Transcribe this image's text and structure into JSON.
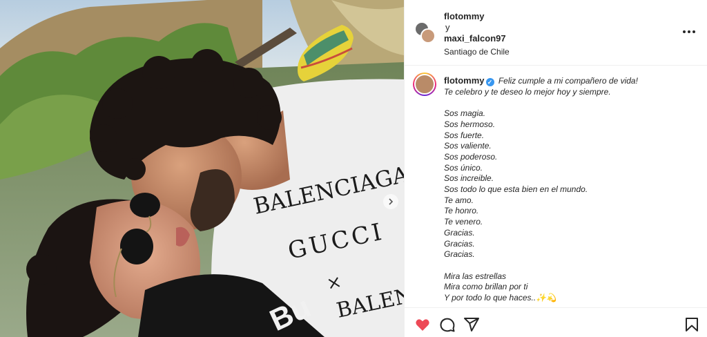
{
  "post": {
    "header": {
      "author": "flotommy",
      "conjunction": "y",
      "collaborator": "maxi_falcon97",
      "location": "Santiago de Chile"
    },
    "caption": {
      "username": "flotommy",
      "verified_glyph": "✓",
      "lines": [
        "Feliz cumple a mi compañero de vida!",
        "Te celebro y te deseo lo mejor hoy y siempre.",
        "",
        "Sos magia.",
        "Sos hermoso.",
        "Sos fuerte.",
        "Sos valiente.",
        "Sos poderoso.",
        "Sos único.",
        "Sos increible.",
        "Sos todo lo que esta bien en el mundo.",
        "Te amo.",
        "Te honro.",
        "Te venero.",
        "Gracias.",
        "Gracias.",
        "Gracias.",
        "",
        "Mira las estrellas",
        "Mira como brillan por ti",
        "Y por todo lo que haces..✨💫"
      ]
    },
    "photo": {
      "shirt_text_1": "BALENCIAGA GUCCI",
      "shirt_text_2": "GUCCI",
      "shirt_text_3": "×",
      "shirt_text_4": "BALENCIAGA",
      "hoodie_text": "Bu"
    },
    "actions": {
      "like_icon": "heart-filled-icon",
      "comment_icon": "comment-icon",
      "share_icon": "share-icon",
      "save_icon": "bookmark-icon",
      "liked": true
    },
    "colors": {
      "like": "#ed4956",
      "verified": "#3897f0",
      "text": "#262626"
    }
  }
}
